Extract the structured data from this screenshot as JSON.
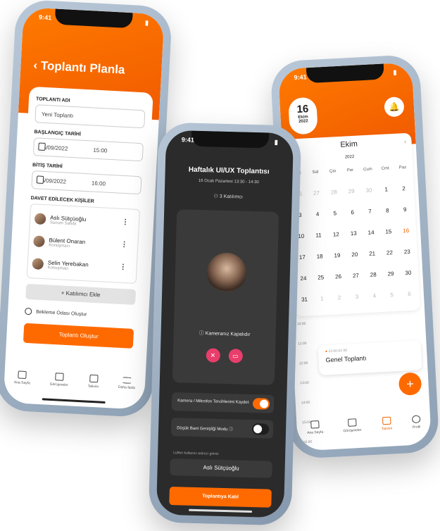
{
  "left_phone": {
    "time": "9:41",
    "title": "Toplantı Planla",
    "meeting_name_label": "TOPLANTI ADI",
    "meeting_name_placeholder": "Yeni Toplantı",
    "start_label": "BAŞLANGIÇ TARİHİ",
    "start_date": "05/09/2022",
    "start_time": "15:00",
    "end_label": "BİTİŞ TARİHİ",
    "end_date": "05/09/2022",
    "end_time": "16:00",
    "invitees_label": "DAVET EDİLECEK KİŞİLER",
    "invitees": [
      {
        "name": "Aslı Sütçüoğlu",
        "role": "Sunum Sahibi"
      },
      {
        "name": "Bülent Onaran",
        "role": "Konuşmacı"
      },
      {
        "name": "Selin Yerebakan",
        "role": "Konuşmacı"
      }
    ],
    "add_participant": "+ Katılımcı Ekle",
    "waiting_room": "Bekleme Odası Oluştur",
    "create_button": "Toplantı Oluştur",
    "tabs": [
      "Ana Sayfa",
      "Görüşmeler",
      "Takvim",
      "Daha fazla"
    ]
  },
  "middle_phone": {
    "time": "9:41",
    "title": "Haftalık UI/UX Toplantısı",
    "subtitle": "16 Ocak Pazartesi 13:30 - 14:30",
    "participants": "3 Katılımcı",
    "camera_off": "Kameranız Kapalıdır",
    "remember_label": "Kamera / Mikrofon Tercihlerimi Kaydet",
    "low_bandwidth_label": "Düşük Bant Genişliği Modu ⓘ",
    "name_prompt": "Lütfen kullanıcı adınızı giriniz",
    "name_value": "Aslı Sütçüoğlu",
    "join_button": "Toplantıya Katıl",
    "colors": {
      "accent": "#ff6a00",
      "danger": "#e83e6c"
    }
  },
  "right_phone": {
    "time": "9:41",
    "badge_day": "16",
    "badge_month": "Ekim",
    "badge_year": "2022",
    "month": "Ekim",
    "year": "2022",
    "weekdays": [
      "Pzt",
      "Sal",
      "Çar",
      "Per",
      "Cum",
      "Cmt",
      "Paz"
    ],
    "days": [
      [
        "26",
        "27",
        "28",
        "29",
        "30",
        "1",
        "2"
      ],
      [
        "3",
        "4",
        "5",
        "6",
        "7",
        "8",
        "9"
      ],
      [
        "10",
        "11",
        "12",
        "13",
        "14",
        "15",
        "16"
      ],
      [
        "17",
        "18",
        "19",
        "20",
        "21",
        "22",
        "23"
      ],
      [
        "24",
        "25",
        "26",
        "27",
        "28",
        "29",
        "30"
      ],
      [
        "31",
        "1",
        "2",
        "3",
        "4",
        "5",
        "6"
      ]
    ],
    "times": [
      "10:00",
      "11:00",
      "12:00",
      "13:00",
      "14:00",
      "15:00",
      "16:00"
    ],
    "event_time": "12:00-01:00",
    "event_name": "Genel Toplantı",
    "tabs": [
      "Ana Sayfa",
      "Görüşmeler",
      "Takvim",
      "Profil"
    ]
  }
}
